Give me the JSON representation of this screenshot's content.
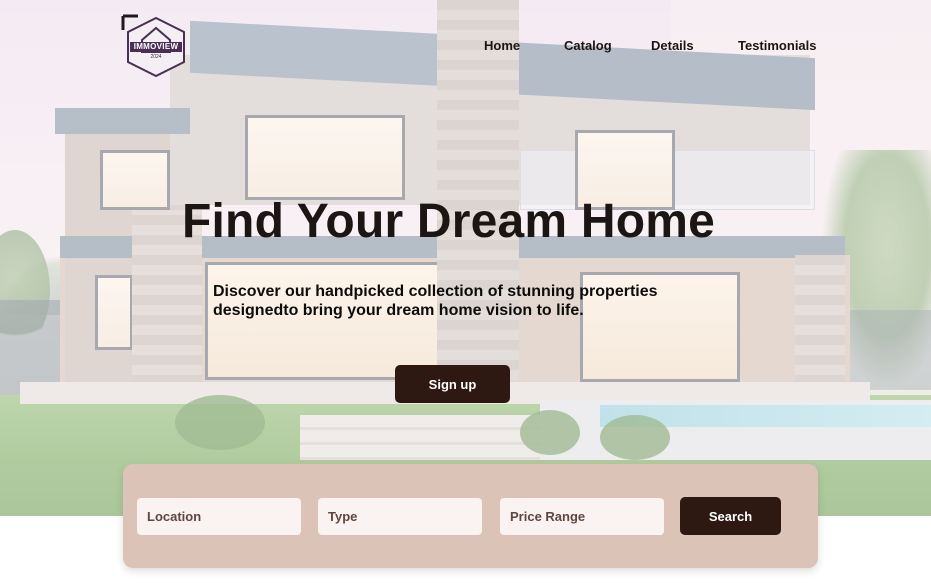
{
  "brand": {
    "logo_text": "IMMOVIEW",
    "logo_year": "2024"
  },
  "nav": {
    "items": [
      {
        "label": "Home"
      },
      {
        "label": "Catalog"
      },
      {
        "label": "Details"
      },
      {
        "label": "Testimonials"
      }
    ]
  },
  "hero": {
    "title": "Find Your Dream Home",
    "subtitle": "Discover our handpicked collection of stunning properties designedto bring your dream home vision to life.",
    "cta_label": "Sign up"
  },
  "search": {
    "location_placeholder": "Location",
    "type_placeholder": "Type",
    "price_placeholder": "Price Range",
    "button_label": "Search"
  },
  "colors": {
    "primary_button": "#2d1912",
    "search_panel": "#dcc3b8",
    "field_background": "#fbf3f1",
    "text_dark": "#1b1614"
  }
}
